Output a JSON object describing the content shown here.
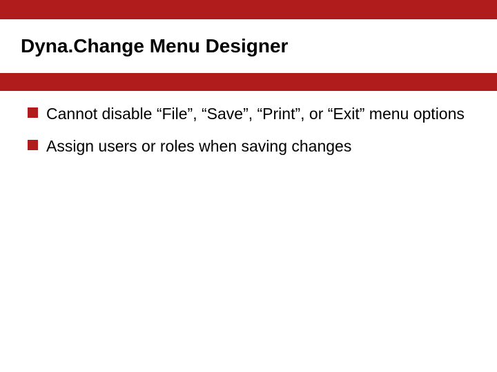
{
  "slide": {
    "title": "Dyna.Change Menu Designer",
    "bullets": [
      "Cannot disable “File”, “Save”, “Print”, or “Exit” menu options",
      "Assign users or roles when saving changes"
    ],
    "colors": {
      "accent": "#b01c1c",
      "background": "#ffffff",
      "text": "#000000"
    }
  }
}
